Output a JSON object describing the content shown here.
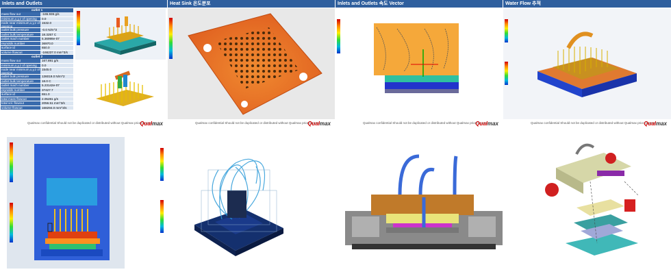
{
  "header": {
    "p1": "Inlets and Outlets",
    "p2": "Heat Sink 온도분포",
    "p3": "Inlets and Outlets 속도 Vector",
    "p4": "Water Flow 추적"
  },
  "footer": {
    "note": "Qualmax  confidential   Should not be duplicated or distributed without Qualmax prior consent",
    "logo_a": "Qual",
    "logo_b": "max"
  },
  "table": {
    "outlet1": {
      "title": "outlet 1",
      "rows": [
        {
          "k": "mass flow out",
          "v": "-165.936  g/s"
        },
        {
          "k": "minimum,x,y,z of opening",
          "v": "0.0"
        },
        {
          "k": "node near minimum,x,y,z of opening",
          "v": "1532.0"
        },
        {
          "k": "outlet bulk pressure",
          "v": "-0.0  N/m^2"
        },
        {
          "k": "outlet bulk temperature",
          "v": "18.3257  C"
        },
        {
          "k": "outlet mach number",
          "v": "5.36999e-07"
        },
        {
          "k": "reynolds number",
          "v": "36970.0"
        },
        {
          "k": "surface id",
          "v": "650.0"
        },
        {
          "k": "volume flowout",
          "v": "-166237.0  mm^3/s"
        }
      ]
    },
    "outlet2": {
      "title": "outlet 2",
      "rows": [
        {
          "k": "mass flow out",
          "v": "167.891  g/s"
        },
        {
          "k": "minimum,x,y,z of opening",
          "v": "0.0"
        },
        {
          "k": "node near minimum,x,y,z of opening",
          "v": "1545.0"
        },
        {
          "k": "outlet bulk pressure",
          "v": "136019.0  N/m^2"
        },
        {
          "k": "outlet bulk temperature",
          "v": "18.0  C"
        },
        {
          "k": "outlet mach number",
          "v": "5.23142e-07"
        },
        {
          "k": "reynolds number",
          "v": "37427.7"
        },
        {
          "k": "surface id",
          "v": "651.0"
        },
        {
          "k": "total mass flowout",
          "v": "2.05281  g/s"
        },
        {
          "k": "total vol. flowout",
          "v": "2056.51  mm^3/s"
        },
        {
          "k": "volume flowout",
          "v": "168294.0  mm^3/s"
        }
      ]
    }
  },
  "colors": {
    "header_bg": "#2f5f9e",
    "hot": "#d20000",
    "mid": "#ffee00",
    "cold": "#0033cc"
  }
}
